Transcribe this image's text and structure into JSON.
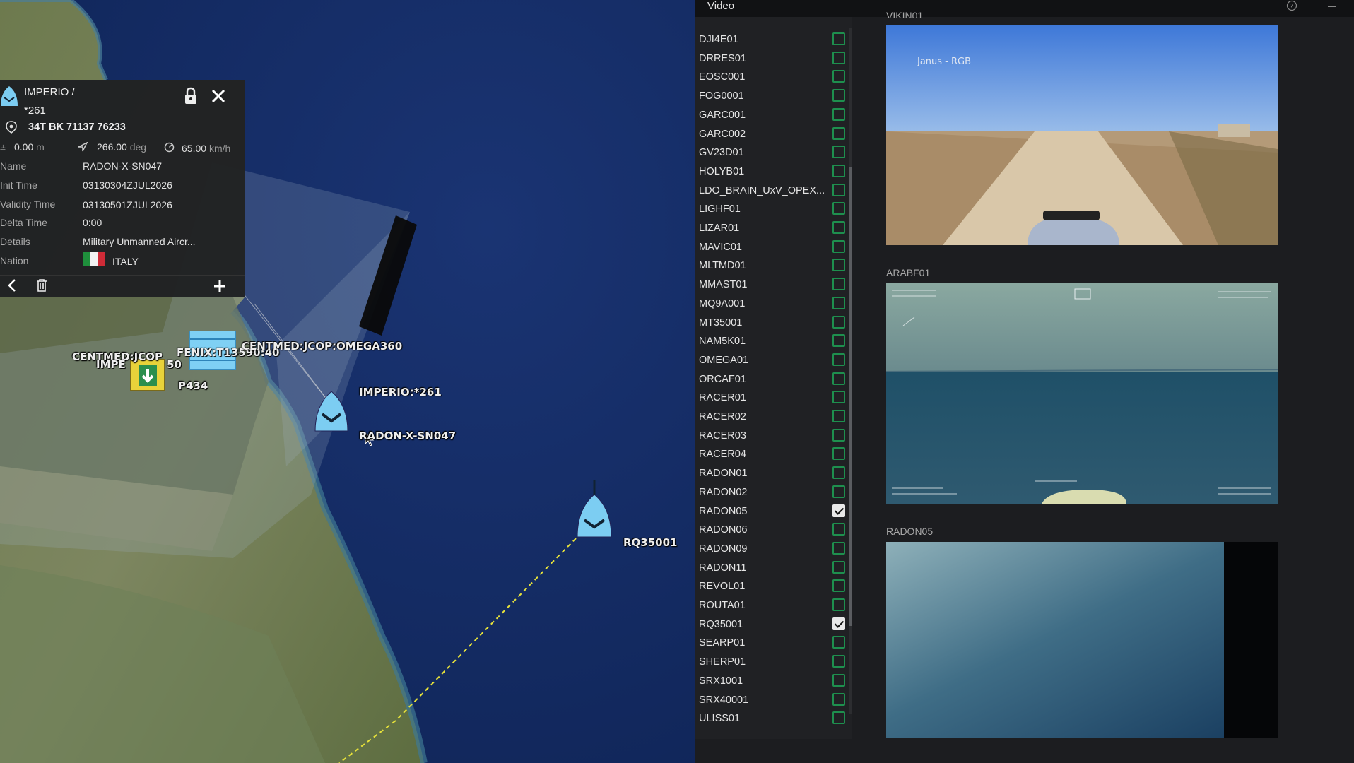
{
  "map": {
    "labels": {
      "centmed_left": "CENTMED:JCOP",
      "impe": "IMPE",
      "fifty": "50",
      "fenix": "FENIX:T13590:40",
      "centmed_omega": "CENTMED:JCOP:OMEGA360",
      "p434": "P434",
      "imperio": "IMPERIO:*261",
      "radon": "RADON-X-SN047",
      "rq": "RQ35001"
    }
  },
  "info_panel": {
    "title_line1": "IMPERIO /",
    "title_line2": "*261",
    "coords": "34T BK 71137 76233",
    "altitude_value": "0.00",
    "altitude_unit": "m",
    "heading_value": "266.00",
    "heading_unit": "deg",
    "speed_value": "65.00",
    "speed_unit": "km/h",
    "rows": [
      {
        "label": "Name",
        "value": "RADON-X-SN047"
      },
      {
        "label": "Init Time",
        "value": "03130304ZJUL2026"
      },
      {
        "label": "Validity Time",
        "value": "03130501ZJUL2026"
      },
      {
        "label": "Delta Time",
        "value": "0:00"
      },
      {
        "label": "Details",
        "value": "Military Unmanned Aircr..."
      },
      {
        "label": "Nation",
        "value": "ITALY"
      }
    ],
    "flag_colors": [
      "#1f8f3c",
      "#f2f2f2",
      "#cf2b37"
    ]
  },
  "video_panel": {
    "title": "Video",
    "items": [
      {
        "label": "DJI4E01",
        "checked": false
      },
      {
        "label": "DRRES01",
        "checked": false
      },
      {
        "label": "EOSC001",
        "checked": false
      },
      {
        "label": "FOG0001",
        "checked": false
      },
      {
        "label": "GARC001",
        "checked": false
      },
      {
        "label": "GARC002",
        "checked": false
      },
      {
        "label": "GV23D01",
        "checked": false
      },
      {
        "label": "HOLYB01",
        "checked": false
      },
      {
        "label": "LDO_BRAIN_UxV_OPEX...",
        "checked": false
      },
      {
        "label": "LIGHF01",
        "checked": false
      },
      {
        "label": "LIZAR01",
        "checked": false
      },
      {
        "label": "MAVIC01",
        "checked": false
      },
      {
        "label": "MLTMD01",
        "checked": false
      },
      {
        "label": "MMAST01",
        "checked": false
      },
      {
        "label": "MQ9A001",
        "checked": false
      },
      {
        "label": "MT35001",
        "checked": false
      },
      {
        "label": "NAM5K01",
        "checked": false
      },
      {
        "label": "OMEGA01",
        "checked": false
      },
      {
        "label": "ORCAF01",
        "checked": false
      },
      {
        "label": "RACER01",
        "checked": false
      },
      {
        "label": "RACER02",
        "checked": false
      },
      {
        "label": "RACER03",
        "checked": false
      },
      {
        "label": "RACER04",
        "checked": false
      },
      {
        "label": "RADON01",
        "checked": false
      },
      {
        "label": "RADON02",
        "checked": false
      },
      {
        "label": "RADON05",
        "checked": true
      },
      {
        "label": "RADON06",
        "checked": false
      },
      {
        "label": "RADON09",
        "checked": false
      },
      {
        "label": "RADON11",
        "checked": false
      },
      {
        "label": "REVOL01",
        "checked": false
      },
      {
        "label": "ROUTA01",
        "checked": false
      },
      {
        "label": "RQ35001",
        "checked": true
      },
      {
        "label": "SEARP01",
        "checked": false
      },
      {
        "label": "SHERP01",
        "checked": false
      },
      {
        "label": "SRX1001",
        "checked": false
      },
      {
        "label": "SRX40001",
        "checked": false
      },
      {
        "label": "ULISS01",
        "checked": false
      }
    ],
    "feeds": [
      {
        "label": "VIKIN01",
        "overlay": "Janus - RGB"
      },
      {
        "label": "ARABF01",
        "overlay": ""
      },
      {
        "label": "RADON05",
        "overlay": ""
      }
    ],
    "accent_color": "#1e8f4e"
  }
}
